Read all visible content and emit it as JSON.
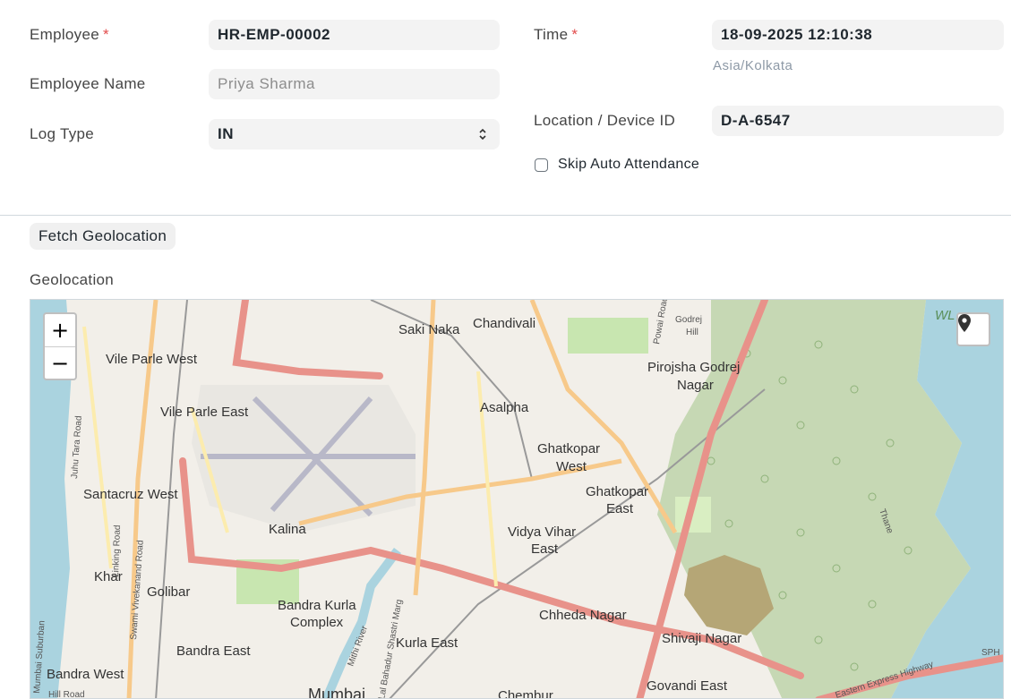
{
  "form": {
    "employee": {
      "label": "Employee",
      "required": "*",
      "value": "HR-EMP-00002"
    },
    "employee_name": {
      "label": "Employee Name",
      "value": "Priya Sharma"
    },
    "log_type": {
      "label": "Log Type",
      "value": "IN"
    },
    "time": {
      "label": "Time",
      "required": "*",
      "value": "18-09-2025 12:10:38",
      "timezone": "Asia/Kolkata"
    },
    "location": {
      "label": "Location / Device ID",
      "value": "D-A-6547"
    },
    "skip_auto": {
      "label": "Skip Auto Attendance",
      "checked": false
    }
  },
  "geo": {
    "fetch_button": "Fetch Geolocation",
    "section_label": "Geolocation",
    "zoom_in": "+",
    "zoom_out": "−",
    "map_labels": {
      "saki_naka": "Saki Naka",
      "chandivali": "Chandivali",
      "vile_parle_west": "Vile Parle West",
      "vile_parle_east": "Vile Parle East",
      "pirojsha_1": "Pirojsha Godrej",
      "pirojsha_2": "Nagar",
      "asalpha": "Asalpha",
      "ghatkopar_w1": "Ghatkopar",
      "ghatkopar_w2": "West",
      "ghatkopar_e1": "Ghatkopar",
      "ghatkopar_e2": "East",
      "santacruz_west": "Santacruz West",
      "kalina": "Kalina",
      "vidya_1": "Vidya Vihar",
      "vidya_2": "East",
      "khar": "Khar",
      "golibar": "Golibar",
      "bkc_1": "Bandra Kurla",
      "bkc_2": "Complex",
      "chheda": "Chheda Nagar",
      "shivaji": "Shivaji Nagar",
      "kurla_east": "Kurla East",
      "bandra_east": "Bandra East",
      "bandra_west": "Bandra West",
      "govandi": "Govandi East",
      "mumbai": "Mumbai",
      "chembur": "Chembur",
      "godrej_hill_1": "Godrej",
      "godrej_hill_2": "Hill",
      "powai_road": "Powai Road",
      "linking_road": "Linking Road",
      "juhu_tara": "Juhu Tara Road",
      "mumbai_suburban": "Mumbai Suburban",
      "swami_road": "Swami Vivekanand Road",
      "mithi": "Mithi River",
      "lbs_marg": "Lal Bahadur Shastri Marg",
      "thane": "Thane",
      "wl": "WL",
      "sph": "SPH",
      "highway": "Eastern Express Highway",
      "hill_road": "Hill Road"
    }
  }
}
